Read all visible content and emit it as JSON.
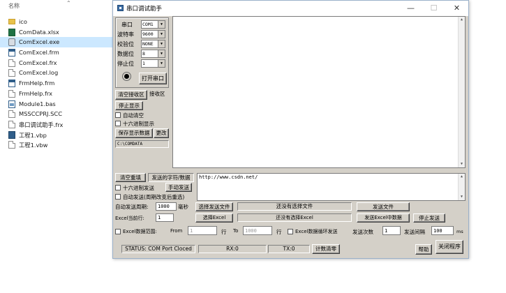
{
  "explorer": {
    "header_label": "名称",
    "items": [
      {
        "name": "ico",
        "icon": "folder-icon",
        "kind": "folder"
      },
      {
        "name": "ComData.xlsx",
        "icon": "excel-file-icon",
        "kind": "xlsx"
      },
      {
        "name": "ComExcel.exe",
        "icon": "exe-icon",
        "kind": "exe",
        "selected": true
      },
      {
        "name": "ComExcel.frm",
        "icon": "vb-form-icon",
        "kind": "frm"
      },
      {
        "name": "ComExcel.frx",
        "icon": "file-icon",
        "kind": "file"
      },
      {
        "name": "ComExcel.log",
        "icon": "file-icon",
        "kind": "file"
      },
      {
        "name": "FrmHelp.frm",
        "icon": "vb-form-icon",
        "kind": "frm"
      },
      {
        "name": "FrmHelp.frx",
        "icon": "file-icon",
        "kind": "file"
      },
      {
        "name": "Module1.bas",
        "icon": "vb-module-icon",
        "kind": "bas"
      },
      {
        "name": "MSSCCPRJ.SCC",
        "icon": "file-icon",
        "kind": "file"
      },
      {
        "name": "串口调试助手.frx",
        "icon": "file-icon",
        "kind": "file"
      },
      {
        "name": "工程1.vbp",
        "icon": "vb-project-icon",
        "kind": "vbp"
      },
      {
        "name": "工程1.vbw",
        "icon": "file-icon",
        "kind": "file"
      }
    ]
  },
  "window": {
    "title": "串口调试助手",
    "controls": {
      "minimize": "—",
      "maximize": "☐",
      "close": "✕"
    }
  },
  "serial": {
    "port_label": "串口",
    "port_value": "COM1",
    "baud_label": "波特率",
    "baud_value": "9600",
    "parity_label": "校验位",
    "parity_value": "NONE",
    "databits_label": "数据位",
    "databits_value": "8",
    "stopbits_label": "停止位",
    "stopbits_value": "1",
    "open_button": "打开串口"
  },
  "receive": {
    "clear_button": "清空接收区",
    "area_label": "接收区",
    "stop_display_button": "停止显示",
    "auto_clear_label": "自动清空",
    "hex_display_label": "十六进制显示",
    "save_button": "保存显示数据",
    "change_button": "更改",
    "save_path": "C:\\COMDATA"
  },
  "send": {
    "clear_resend_button": "清空重填",
    "chars_label": "发送的字符/数据",
    "hex_send_label": "十六进制发送",
    "manual_send_button": "手动发送",
    "auto_send_label": "自动发送(周期改变后重选)",
    "period_label": "自动发送周期:",
    "period_value": "1000",
    "period_unit": "毫秒",
    "content": "http://www.csdn.net/"
  },
  "file_send": {
    "choose_file_button": "选择发送文件",
    "status_file": "还没有选择文件",
    "send_file_button": "发送文件"
  },
  "excel": {
    "current_row_label": "Excel当前行:",
    "current_row_value": "1",
    "choose_excel_button": "选择Excel",
    "status_excel": "还没有选择Excel",
    "send_excel_button": "发送Excel中数据",
    "stop_send_button": "停止发送",
    "range_label": "Excel数据范围:",
    "from_label": "From",
    "from_value": "1",
    "row_label_1": "行",
    "to_label": "To",
    "to_value": "1000",
    "row_label_2": "行",
    "loop_label": "Excel数据循环发送",
    "send_count_label": "发送次数",
    "send_count_value": "1",
    "interval_label": "发送间隔",
    "interval_value": "100",
    "interval_unit": "ms"
  },
  "status": {
    "status_text": "STATUS: COM Port Cloced",
    "rx_text": "RX:0",
    "tx_text": "TX:0",
    "reset_count_button": "计数清零",
    "help_button": "帮助",
    "exit_button": "关闭程序"
  }
}
